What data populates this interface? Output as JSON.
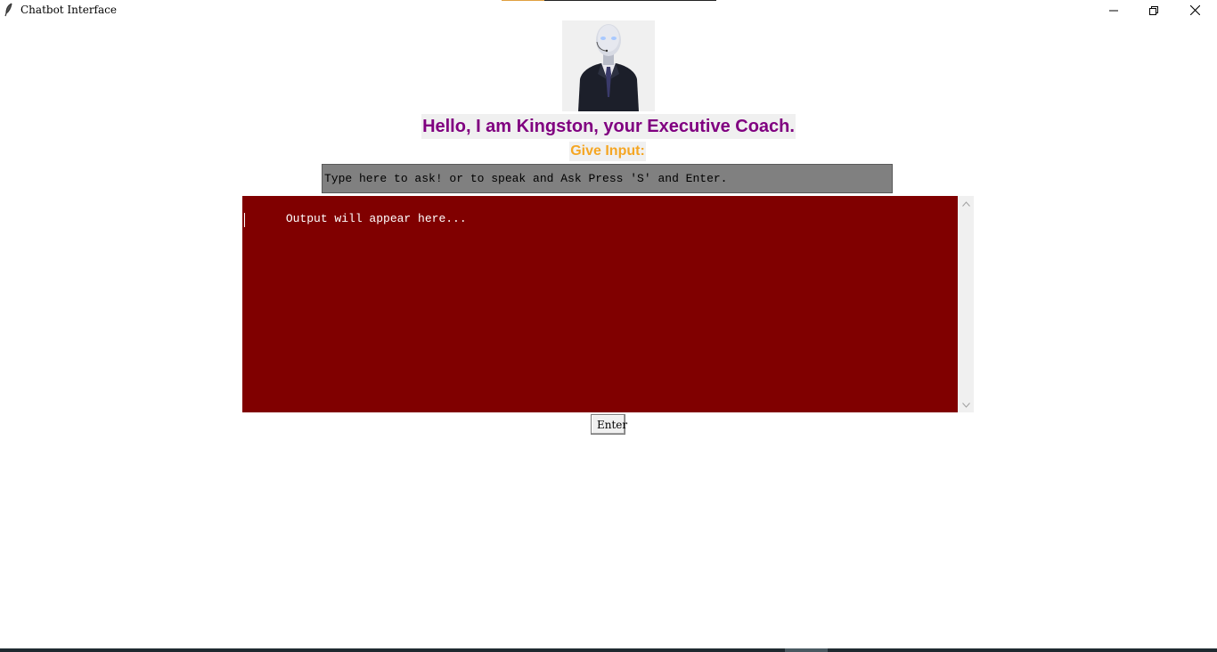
{
  "window": {
    "title": "Chatbot Interface",
    "icons": {
      "app": "feather-icon",
      "minimize": "minimize-icon",
      "maximize": "restore-icon",
      "close": "close-icon"
    }
  },
  "header": {
    "avatar_icon": "robot-avatar",
    "greeting": "Hello, I am Kingston, your Executive Coach.",
    "input_label": "Give Input:"
  },
  "input": {
    "value": "Type here to ask! or to speak and Ask Press 'S' and Enter."
  },
  "output": {
    "text": "Output will appear here..."
  },
  "actions": {
    "enter_label": "Enter"
  },
  "colors": {
    "greeting": "#800080",
    "input_label": "#f5a623",
    "input_bg": "#808080",
    "output_bg": "#800000",
    "output_text": "#ffffff"
  }
}
